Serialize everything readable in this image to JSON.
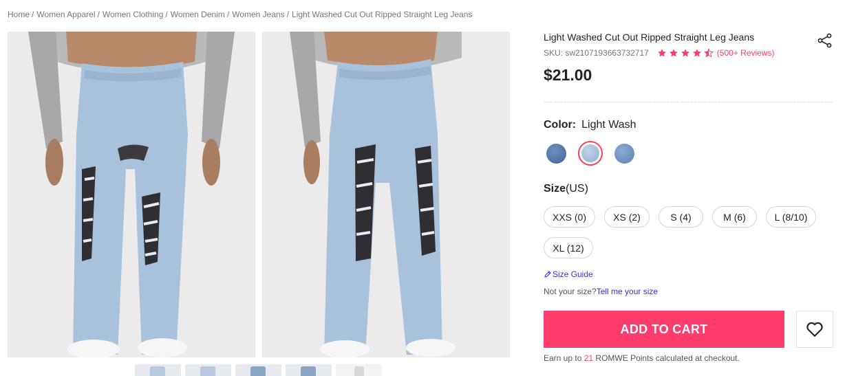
{
  "breadcrumb": [
    "Home",
    "Women Apparel",
    "Women Clothing",
    "Women Denim",
    "Women Jeans",
    "Light Washed Cut Out Ripped Straight Leg Jeans"
  ],
  "breadcrumb_separator": "/",
  "product": {
    "title": "Light Washed Cut Out Ripped Straight Leg Jeans",
    "sku": "SKU: sw2107193663732717",
    "rating_stars": 4.5,
    "reviews": "(500+ Reviews)",
    "price": "$21.00"
  },
  "color": {
    "label": "Color:",
    "value": "Light Wash",
    "swatches": [
      {
        "name": "Dark Wash",
        "hex": "#4a72a3",
        "selected": false
      },
      {
        "name": "Light Wash",
        "hex": "#a9c2dc",
        "selected": true
      },
      {
        "name": "Medium Wash",
        "hex": "#6f93c6",
        "selected": false
      }
    ]
  },
  "size": {
    "label": "Size",
    "unit": "(US)",
    "options": [
      "XXS (0)",
      "XS (2)",
      "S (4)",
      "M (6)",
      "L (8/10)",
      "XL (12)"
    ]
  },
  "size_guide": "Size Guide",
  "fit": {
    "prefix": "Not your size?",
    "link": "Tell me your size"
  },
  "add_to_cart": "ADD TO CART",
  "points": {
    "prefix": "Earn up to",
    "num": "21",
    "suffix": "ROMWE Points calculated at checkout."
  },
  "icons": {
    "share": "share-icon",
    "wishlist": "heart-icon",
    "size_guide": "pencil-icon",
    "star": "star-icon"
  },
  "colors": {
    "accent": "#ff3c6b",
    "link": "#3a2bd6",
    "text": "#222222",
    "muted": "#767676"
  }
}
